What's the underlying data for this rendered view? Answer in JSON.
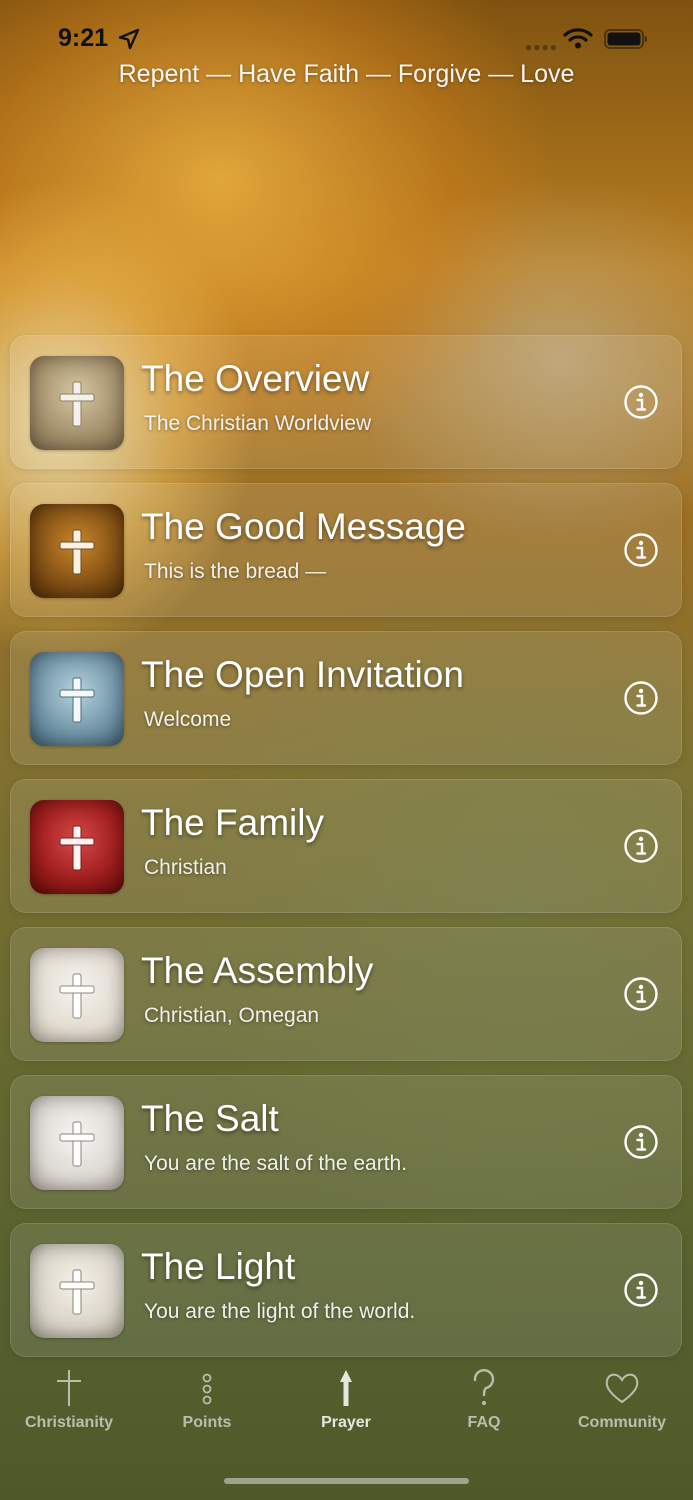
{
  "status_bar": {
    "time": "9:21"
  },
  "header": {
    "tagline": "Repent — Have Faith — Forgive — Love"
  },
  "list": {
    "items": [
      {
        "title": "The Overview",
        "subtitle": "The Christian Worldview",
        "tile_color": "#a59270"
      },
      {
        "title": "The Good Message",
        "subtitle": "This is the bread —",
        "tile_color": "#7a4a12"
      },
      {
        "title": "The Open Invitation",
        "subtitle": "Welcome",
        "tile_color": "#6f93a6"
      },
      {
        "title": "The Family",
        "subtitle": "Christian",
        "tile_color": "#9c1c1c"
      },
      {
        "title": "The Assembly",
        "subtitle": "Christian, Omegan",
        "tile_color": "#e3ddd2"
      },
      {
        "title": "The Salt",
        "subtitle": "You are the salt of the earth.",
        "tile_color": "#dcd8d2"
      },
      {
        "title": "The Light",
        "subtitle": "You are the light of the world.",
        "tile_color": "#d9d4c8"
      }
    ]
  },
  "tab_bar": {
    "tabs": [
      {
        "label": "Christianity",
        "icon": "cross-icon"
      },
      {
        "label": "Points",
        "icon": "points-icon"
      },
      {
        "label": "Prayer",
        "icon": "prayer-arrow-icon",
        "active": true
      },
      {
        "label": "FAQ",
        "icon": "question-icon"
      },
      {
        "label": "Community",
        "icon": "heart-icon"
      }
    ]
  }
}
